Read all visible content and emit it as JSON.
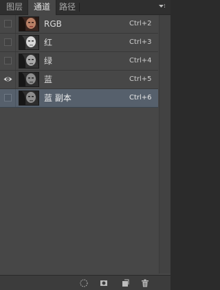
{
  "tabs": [
    {
      "label": "图层",
      "active": false
    },
    {
      "label": "通道",
      "active": true
    },
    {
      "label": "路径",
      "active": false
    }
  ],
  "panel_menu_icon": "panel-menu-icon",
  "channels": [
    {
      "name": "RGB",
      "shortcut": "Ctrl+2",
      "visible": false,
      "thumb": "color",
      "selected": false
    },
    {
      "name": "红",
      "shortcut": "Ctrl+3",
      "visible": false,
      "thumb": "gray-light",
      "selected": false
    },
    {
      "name": "绿",
      "shortcut": "Ctrl+4",
      "visible": false,
      "thumb": "gray-mid",
      "selected": false
    },
    {
      "name": "蓝",
      "shortcut": "Ctrl+5",
      "visible": true,
      "thumb": "gray-dark",
      "selected": false
    },
    {
      "name": "蓝 副本",
      "shortcut": "Ctrl+6",
      "visible": false,
      "thumb": "gray-dark",
      "selected": true
    }
  ],
  "footer_icons": [
    "load-selection-icon",
    "save-selection-icon",
    "new-channel-icon",
    "delete-channel-icon"
  ],
  "colors": {
    "panel_bg": "#474747",
    "selected_row": "#56606c",
    "tab_bar": "#2f2f2f"
  }
}
